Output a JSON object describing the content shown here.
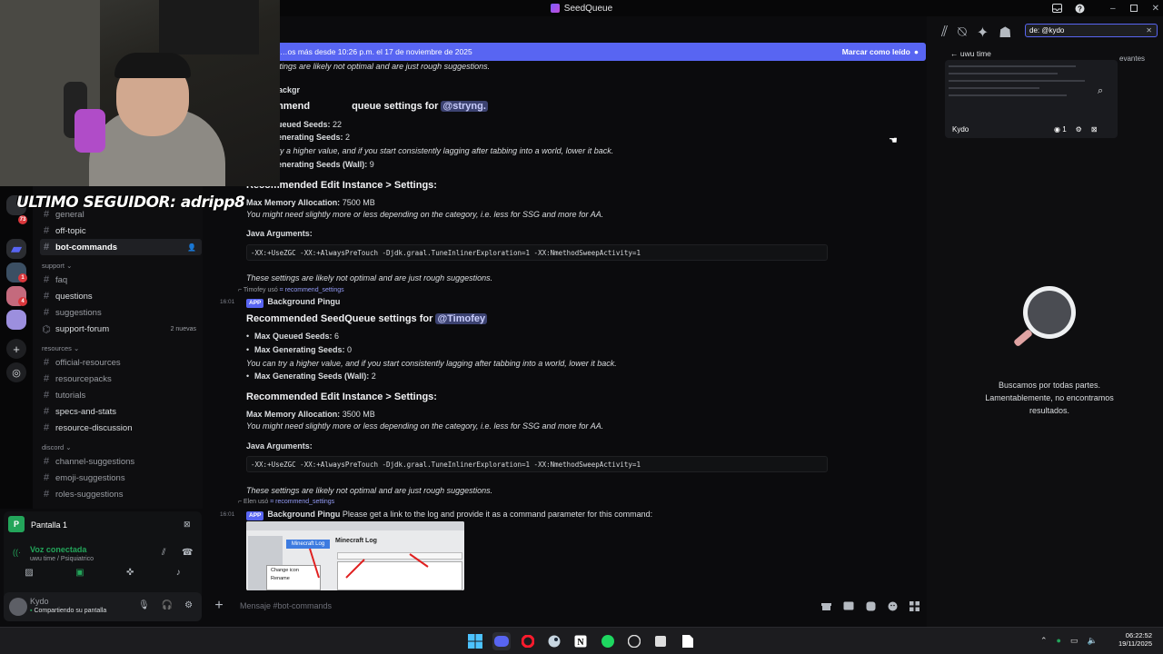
{
  "window": {
    "title": "SeedQueue"
  },
  "overlay": {
    "follower_text": "ULTIMO SEGUIDOR: adripp8"
  },
  "banner": {
    "text": "…os más desde 10:26 p.m. el 17 de noviembre de 2025",
    "action": "Marcar como leído"
  },
  "channels": {
    "items": [
      {
        "label": "general"
      },
      {
        "label": "off-topic"
      },
      {
        "label": "bot-commands"
      }
    ],
    "cat_support": "support",
    "support": [
      {
        "label": "faq"
      },
      {
        "label": "questions"
      },
      {
        "label": "suggestions"
      },
      {
        "label": "support-forum",
        "badge": "2 nuevas"
      }
    ],
    "cat_resources": "resources",
    "resources": [
      {
        "label": "official-resources"
      },
      {
        "label": "resourcepacks"
      },
      {
        "label": "tutorials"
      },
      {
        "label": "specs-and-stats"
      },
      {
        "label": "resource-discussion"
      }
    ],
    "cat_discord": "discord",
    "discord": [
      {
        "label": "channel-suggestions"
      },
      {
        "label": "emoji-suggestions"
      },
      {
        "label": "roles-suggestions"
      }
    ]
  },
  "servers": {
    "badges": [
      "73",
      "1",
      "4"
    ]
  },
  "screen_share": {
    "title": "Pantalla 1",
    "voice": "Voz conectada",
    "voice_sub": "uwu time / Psiquiatrico"
  },
  "user": {
    "name": "Kydo",
    "status": "Compartiendo su pantalla"
  },
  "chat": {
    "top1": "ettings are likely not optimal and are just rough suggestions.",
    "top2": "ackgr",
    "h1_pre": "ecommend",
    "h1_mid": "queue settings for ",
    "h1_mention": "@stryng.",
    "q1_label": "ueued Seeds: ",
    "q1_val": "22",
    "g1_label": "enerating Seeds: ",
    "g1_val": "2",
    "try1": "ry a higher value, and if you start consistently lagging after tabbing into a world, lower it back.",
    "w1_label": "enerating Seeds (Wall): ",
    "w1_val": "9",
    "edit_heading": "Recommended Edit Instance > Settings:",
    "mem1_label": "Max Memory Allocation: ",
    "mem1_val": "7500 MB",
    "need": "You might need slightly more or less depending on the category, i.e. less for SSG and more for AA.",
    "java": "Java Arguments:",
    "java_args": "-XX:+UseZGC -XX:+AlwaysPreTouch -Djdk.graal.TuneInlinerExploration=1 -XX:NmethodSweepActivity=1",
    "not_optimal": "These settings are likely not optimal and are just rough suggestions.",
    "m2_user": "Timofey usó",
    "m2_cmd": "recommend_settings",
    "time1": "16:01",
    "app": "APP",
    "bot": "Background Pingu",
    "h2": "Recommended SeedQueue settings for ",
    "h2_mention": "@Timofey",
    "q2_label": "Max Queued Seeds: ",
    "q2_val": "6",
    "g2_label": "Max Generating Seeds: ",
    "g2_val": "0",
    "try2": "You can try a higher value, and if you start consistently lagging after tabbing into a world, lower it back.",
    "w2_label": "Max Generating Seeds (Wall): ",
    "w2_val": "2",
    "mem2_val": "3500 MB",
    "m3_user": "Elen usó",
    "m3_cmd": "recommend_settings",
    "time2": "16:01",
    "bot_msg": "Please get a link to the log and provide it as a command parameter for this command:",
    "embed_title": "Minecraft Log",
    "embed_btn": "Minecraft Log",
    "embed_menu": [
      "Change icon",
      "Rename"
    ],
    "composer_placeholder": "Mensaje #bot-commands"
  },
  "search": {
    "query": "de: @kydo",
    "thread_title": "uwu time",
    "relevant": "evantes",
    "stream_user": "Kydo",
    "viewers": "1",
    "empty_line1": "Buscamos por todas partes.",
    "empty_line2": "Lamentablemente, no encontramos",
    "empty_line3": "resultados."
  },
  "taskbar": {
    "time": "06:22:52",
    "date": "19/11/2025"
  },
  "colors": {
    "accent": "#5865f2",
    "bg": "#0b0b0d"
  }
}
